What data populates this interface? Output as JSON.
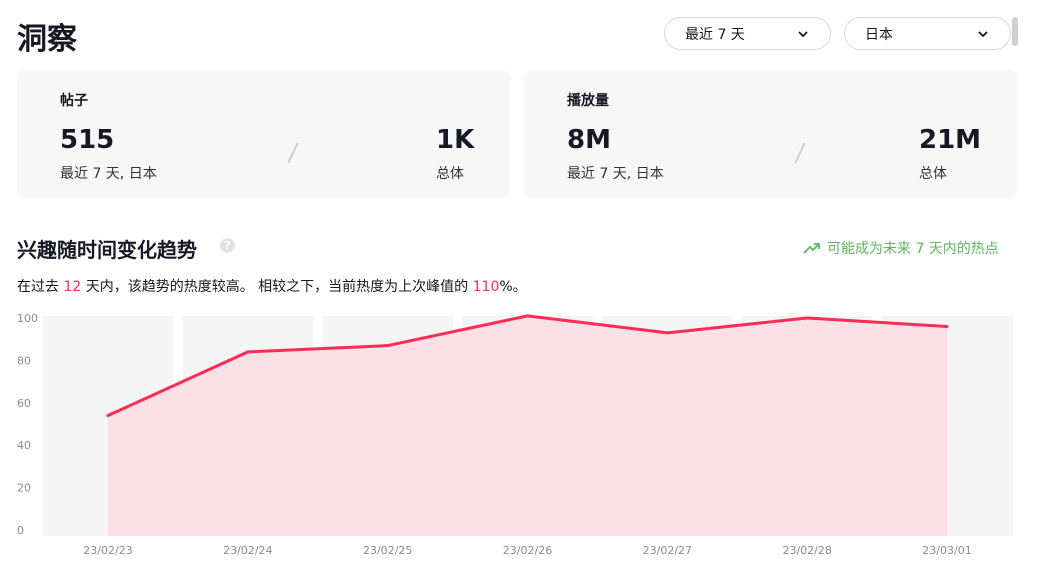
{
  "header": {
    "title": "洞察"
  },
  "filters": {
    "period": "最近 7 天",
    "region": "日本"
  },
  "cards": [
    {
      "title": "帖子",
      "recent_value": "515",
      "recent_label": "最近 7 天, 日本",
      "total_value": "1K",
      "total_label": "总体"
    },
    {
      "title": "播放量",
      "recent_value": "8M",
      "recent_label": "最近 7 天, 日本",
      "total_value": "21M",
      "total_label": "总体"
    }
  ],
  "trend": {
    "title": "兴趣随时间变化趋势",
    "help_icon": "?",
    "hot_label": "可能成为未来 7 天内的热点",
    "desc_prefix": "在过去 ",
    "desc_days": "12",
    "desc_mid": " 天内，该趋势的热度较高。 相较之下，当前热度为上次峰值的 ",
    "desc_percent": "110",
    "desc_suffix": "%。"
  },
  "colors": {
    "accent": "#fe2c55",
    "area": "#fbe1e6",
    "hot": "#5cb85c",
    "band": "#f5f5f5"
  },
  "chart_data": {
    "type": "area",
    "x": [
      "23/02/23",
      "23/02/24",
      "23/02/25",
      "23/02/26",
      "23/02/27",
      "23/02/28",
      "23/03/01"
    ],
    "values": [
      54,
      84,
      87,
      101,
      93,
      100,
      96
    ],
    "ylim": [
      0,
      100
    ],
    "yticks": [
      0,
      20,
      40,
      60,
      80,
      100
    ],
    "grid": false,
    "legend": "none"
  }
}
